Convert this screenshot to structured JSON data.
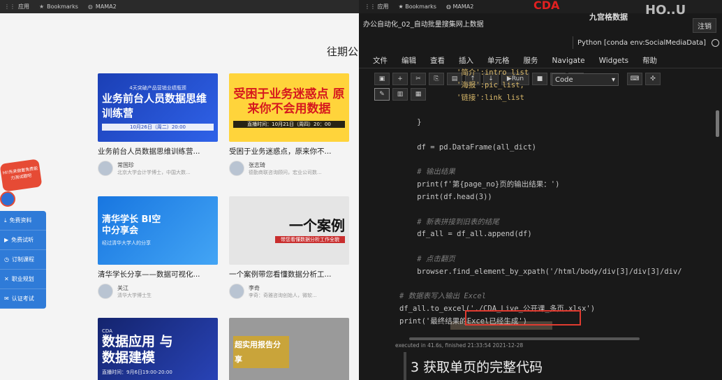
{
  "browser_left": {
    "bookmarks": [
      "应用",
      "Bookmarks",
      "MAMA2"
    ],
    "page_title": "往期公",
    "promo": {
      "label": "HI!先来做套免费能力测试题吧"
    },
    "sidebar": [
      "免费资料",
      "免费试听",
      "订制课程",
      "职业规划",
      "认证考试"
    ],
    "cards": [
      {
        "thumb_main": "业务前台人员数据思维训练营",
        "thumb_sub": "10月26日（周二）20:00",
        "thumb_top": "4天突破产品营销业绩瓶颈",
        "title": "业务前台人员数据思维训练营...",
        "author": "常国珍",
        "desc": "北京大学会计学博士，中国大数..."
      },
      {
        "thumb_main": "受困于业务迷惑点 原来你不会用数据",
        "thumb_sub": "直播时间：10月21日（周四）20：00",
        "thumb_top": "",
        "title": "受困于业务迷惑点，原来你不...",
        "author": "张志琦",
        "desc": "德勤商联咨询顾问，宏业公司数..."
      },
      {
        "thumb_main": "清华学长 BI空中分享会",
        "thumb_sub": "经过清华大学人的分享",
        "thumb_top": "",
        "title": "清华学长分享——数据可视化...",
        "author": "关江",
        "desc": "清华大学博士生"
      },
      {
        "thumb_main": "一个案例",
        "thumb_sub": "带您看懂数据分析工作全貌",
        "thumb_top": "",
        "title": "一个案例带您看懂数据分析工...",
        "author": "李奇",
        "desc": "李奇：奇雅咨询创始人，微软..."
      },
      {
        "thumb_main": "数据应用 与数据建模",
        "thumb_sub": "直播时间：9月6日19:00-20:00",
        "thumb_top": "CDA",
        "title": "",
        "author": "",
        "desc": ""
      },
      {
        "thumb_main": "超实用报告分享",
        "thumb_sub": "",
        "thumb_top": "",
        "title": "",
        "author": "",
        "desc": ""
      }
    ]
  },
  "jupyter": {
    "bookmarks": [
      "应用",
      "Bookmarks",
      "MAMA2"
    ],
    "logos": [
      "CDA",
      "九宫格数据",
      "HO..U"
    ],
    "notebook_title": "办公自动化_02_自动批量搜集网上数据",
    "logout_label": "注销",
    "kernel": "Python [conda env:SocialMediaData]",
    "menu": [
      "文件",
      "编辑",
      "查看",
      "插入",
      "单元格",
      "服务",
      "Navigate",
      "Widgets",
      "帮助"
    ],
    "toolbar_run": "Run",
    "cell_type": "Code",
    "code_lines": [
      {
        "t": "'简介':intro_list",
        "c": "st"
      },
      {
        "t": "'海报':pic_list,",
        "c": "st"
      },
      {
        "t": "'链接':link_list",
        "c": "st"
      },
      {
        "t": "",
        "c": ""
      },
      {
        "t": "    }",
        "c": ""
      },
      {
        "t": "",
        "c": ""
      },
      {
        "t": "    df = pd.DataFrame(all_dict)",
        "c": ""
      },
      {
        "t": "",
        "c": ""
      },
      {
        "t": "    # 输出结果",
        "c": "cm"
      },
      {
        "t": "    print(f'第{page_no}页的输出结果：')",
        "c": ""
      },
      {
        "t": "    print(df.head(3))",
        "c": ""
      },
      {
        "t": "",
        "c": ""
      },
      {
        "t": "    # 新表拼接到旧表的结尾",
        "c": "cm"
      },
      {
        "t": "    df_all = df_all.append(df)",
        "c": ""
      },
      {
        "t": "",
        "c": ""
      },
      {
        "t": "    # 点击翻页",
        "c": "cm"
      },
      {
        "t": "    browser.find_element_by_xpath('/html/body/div[3]/div[3]/div/",
        "c": ""
      },
      {
        "t": "",
        "c": ""
      },
      {
        "t": "# 数据表写入输出 Excel",
        "c": "cm"
      },
      {
        "t": "df_all.to_excel('./CDA_Live_公开课_多页.xlsx')",
        "c": ""
      },
      {
        "t": "print('最终结果的Excel已经生成')",
        "c": ""
      }
    ],
    "exec_status": "executed in 41.6s, finished 21:33:54 2021-12-28",
    "section_heading": "3  获取单页的完整代码"
  }
}
